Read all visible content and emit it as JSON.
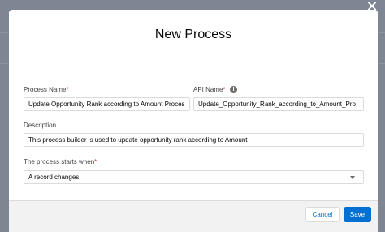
{
  "modal": {
    "title": "New Process",
    "close_icon": "close-icon"
  },
  "form": {
    "process_name": {
      "label": "Process Name",
      "required_mark": "*",
      "value": "Update Opportunity Rank according to Amount Proces"
    },
    "api_name": {
      "label": "API Name",
      "required_mark": "*",
      "info_icon": "info-icon",
      "value": "Update_Opportunity_Rank_according_to_Amount_Pro"
    },
    "description": {
      "label": "Description",
      "value": "This process builder is used to update opportunity rank according to Amount"
    },
    "starts_when": {
      "label": "The process starts when",
      "required_mark": "*",
      "selected": "A record changes"
    }
  },
  "footer": {
    "cancel_label": "Cancel",
    "save_label": "Save"
  },
  "colors": {
    "brand_blue": "#0070d2",
    "required_red": "#c23934",
    "backdrop": "#7e8694"
  }
}
